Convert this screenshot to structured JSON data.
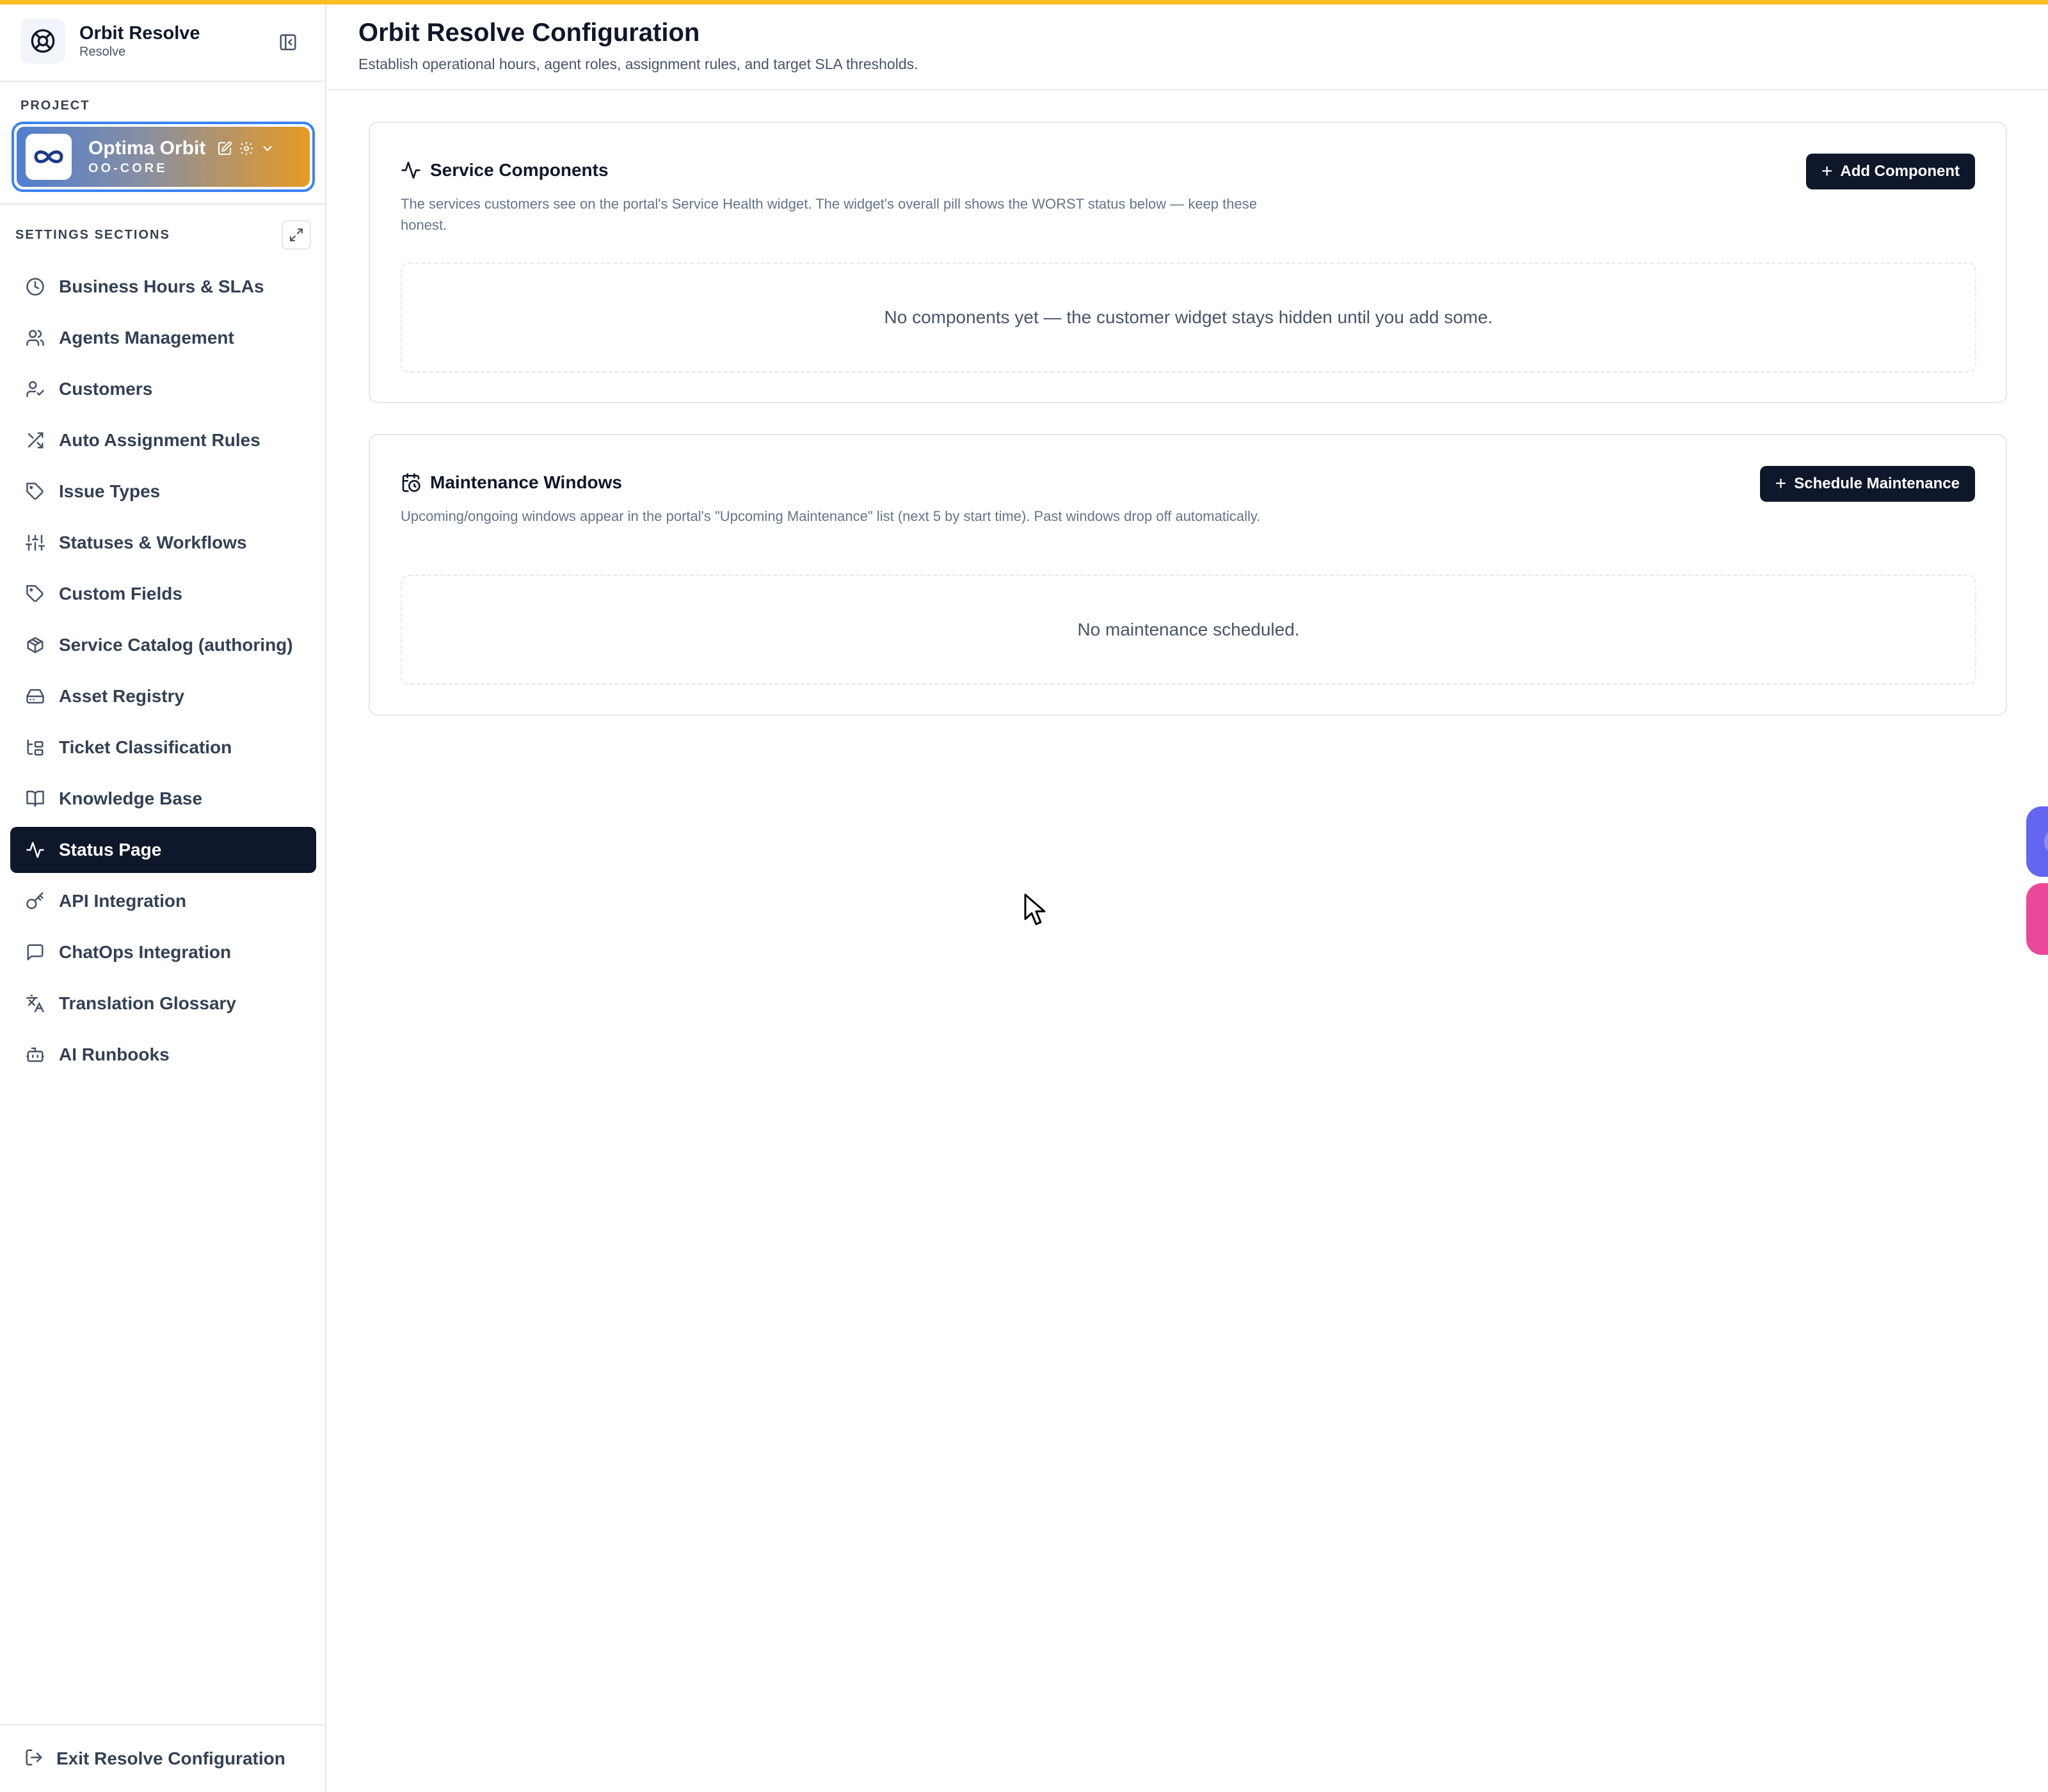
{
  "app": {
    "name": "Orbit Resolve",
    "subtitle": "Resolve"
  },
  "sidebar": {
    "project_label": "PROJECT",
    "project": {
      "name": "Optima Orbit",
      "code": "OO-CORE"
    },
    "sections_label": "SETTINGS SECTIONS",
    "items": [
      {
        "label": "Business Hours & SLAs",
        "icon": "clock-icon"
      },
      {
        "label": "Agents Management",
        "icon": "users-icon"
      },
      {
        "label": "Customers",
        "icon": "user-check-icon"
      },
      {
        "label": "Auto Assignment Rules",
        "icon": "shuffle-icon"
      },
      {
        "label": "Issue Types",
        "icon": "tag-icon"
      },
      {
        "label": "Statuses & Workflows",
        "icon": "sliders-icon"
      },
      {
        "label": "Custom Fields",
        "icon": "tag-icon"
      },
      {
        "label": "Service Catalog (authoring)",
        "icon": "package-icon"
      },
      {
        "label": "Asset Registry",
        "icon": "hard-drive-icon"
      },
      {
        "label": "Ticket Classification",
        "icon": "folder-tree-icon"
      },
      {
        "label": "Knowledge Base",
        "icon": "book-open-icon"
      },
      {
        "label": "Status Page",
        "icon": "activity-icon",
        "active": true
      },
      {
        "label": "API Integration",
        "icon": "key-icon"
      },
      {
        "label": "ChatOps Integration",
        "icon": "message-square-icon"
      },
      {
        "label": "Translation Glossary",
        "icon": "languages-icon"
      },
      {
        "label": "AI Runbooks",
        "icon": "bot-icon"
      }
    ],
    "exit_label": "Exit Resolve Configuration"
  },
  "header": {
    "title": "Orbit Resolve Configuration",
    "subtitle": "Establish operational hours, agent roles, assignment rules, and target SLA thresholds."
  },
  "cards": {
    "components": {
      "title": "Service Components",
      "description": "The services customers see on the portal's Service Health widget. The widget's overall pill shows the WORST status below — keep these honest.",
      "button": "Add Component",
      "empty": "No components yet — the customer widget stays hidden until you add some."
    },
    "maintenance": {
      "title": "Maintenance Windows",
      "description": "Upcoming/ongoing windows appear in the portal's \"Upcoming Maintenance\" list (next 5 by start time). Past windows drop off automatically.",
      "button": "Schedule Maintenance",
      "empty": "No maintenance scheduled."
    }
  },
  "colors": {
    "accent_bar": "#fbbf24",
    "active_nav": "#0f172a",
    "primary_button": "#0f172a",
    "project_border": "#3b82f6"
  }
}
